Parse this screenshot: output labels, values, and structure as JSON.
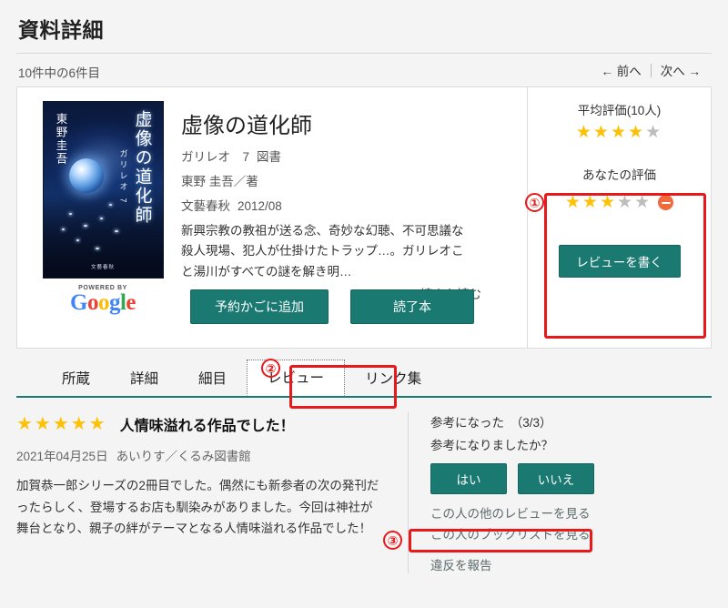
{
  "header": {
    "title": "資料詳細",
    "count_text": "10件中の6件目",
    "prev_label": "← 前へ",
    "next_label": "次へ →"
  },
  "book": {
    "title": "虚像の道化師",
    "series": "ガリレオ　7",
    "material_type": "図書",
    "author": "東野 圭吾／著",
    "publisher": "文藝春秋",
    "pubdate": "2012/08",
    "description": "新興宗教の教祖が送る念、奇妙な幻聴、不可思議な殺人現場、犯人が仕掛けたトラップ…。ガリレオこと湯川がすべての謎を解き明…",
    "more_label": "続きを読む",
    "more_chevron": "chevron-down-icon",
    "cover": {
      "title_vertical": "虚像の道化師",
      "series_vertical": "ガリレオ 7",
      "author_vertical": "東野圭吾",
      "publisher_mark": "文藝春秋"
    },
    "powered_by": "POWERED BY",
    "google_letters": [
      "G",
      "o",
      "o",
      "g",
      "l",
      "e"
    ],
    "buttons": {
      "reserve": "予約かごに追加",
      "read": "読了本"
    }
  },
  "rating_panel": {
    "average_label": "平均評価(10人)",
    "average_value": 4,
    "average_max": 5,
    "your_label": "あなたの評価",
    "your_value": 3,
    "your_max": 5,
    "clear_icon": "minus-circle-icon",
    "write_review_label": "レビューを書く"
  },
  "tabs": [
    {
      "label": "所蔵",
      "active": false
    },
    {
      "label": "詳細",
      "active": false
    },
    {
      "label": "細目",
      "active": false
    },
    {
      "label": "レビュー",
      "active": true
    },
    {
      "label": "リンク集",
      "active": false
    }
  ],
  "review": {
    "stars": 5,
    "stars_max": 5,
    "title": "人情味溢れる作品でした！",
    "date": "2021年04月25日",
    "author": "あいりす／くるみ図書館",
    "body": "加賀恭一郎シリーズの2冊目でした。偶然にも新参者の次の発刊だったらしく、登場するお店も馴染みがありました。今回は神社が舞台となり、親子の絆がテーマとなる人情味溢れる作品でした！",
    "helpful_count_label": "参考になった　（3/3）",
    "helpful_question": "参考になりましたか？",
    "yes_label": "はい",
    "no_label": "いいえ",
    "other_reviews_link": "この人の他のレビューを見る",
    "booklist_link": "この人のブックリストを見る",
    "report_link": "違反を報告"
  },
  "annotations": [
    {
      "number": "①"
    },
    {
      "number": "②"
    },
    {
      "number": "③"
    }
  ],
  "colors": {
    "accent_teal": "#1a7a72",
    "star_on": "#FFC107",
    "star_off": "#bdbdbd",
    "annotation_red": "#e8191a",
    "minus_orange": "#ef6b3d"
  }
}
